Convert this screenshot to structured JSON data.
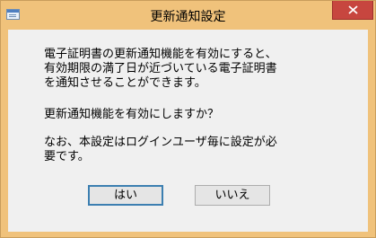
{
  "dialog": {
    "title": "更新通知設定",
    "icon": "dialog-app-icon",
    "message_line1": "電子証明書の更新通知機能を有効にすると、\n有効期限の満了日が近づいている電子証明書\nを通知させることができます。",
    "message_line2": "更新通知機能を有効にしますか？",
    "message_line3": "なお、本設定はログインユーザ毎に設定が必\n要です。",
    "yes_label": "はい",
    "no_label": "いいえ"
  },
  "colors": {
    "frame": "#f0c27b",
    "close": "#c7463f",
    "client": "#f0f0f0",
    "focus_border": "#3c7fb1"
  }
}
